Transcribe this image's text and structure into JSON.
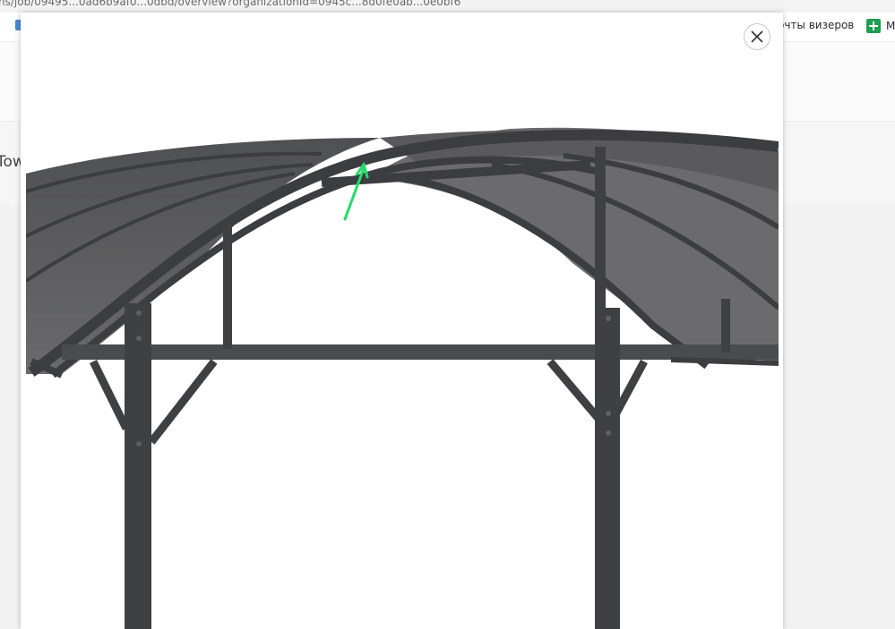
{
  "browser": {
    "url_fragment": "ns/job/09495...0ad6b9af0...0dbd/overview?organizationId=0945c...8d0fe0ab...0e0bf6",
    "bookmarks": [
      {
        "label": "очты визеров",
        "icon": "bookmark-icon"
      },
      {
        "label": "M",
        "icon": "google-sheets-icon"
      }
    ]
  },
  "page_behind": {
    "partial_text": "Tow"
  },
  "modal": {
    "close_icon": "close-icon",
    "image_subject": "gazebo-roof-render",
    "annotation_arrow_color": "#22dd66",
    "roof_color": "#5a5a5c",
    "frame_color": "#3c3d40"
  }
}
